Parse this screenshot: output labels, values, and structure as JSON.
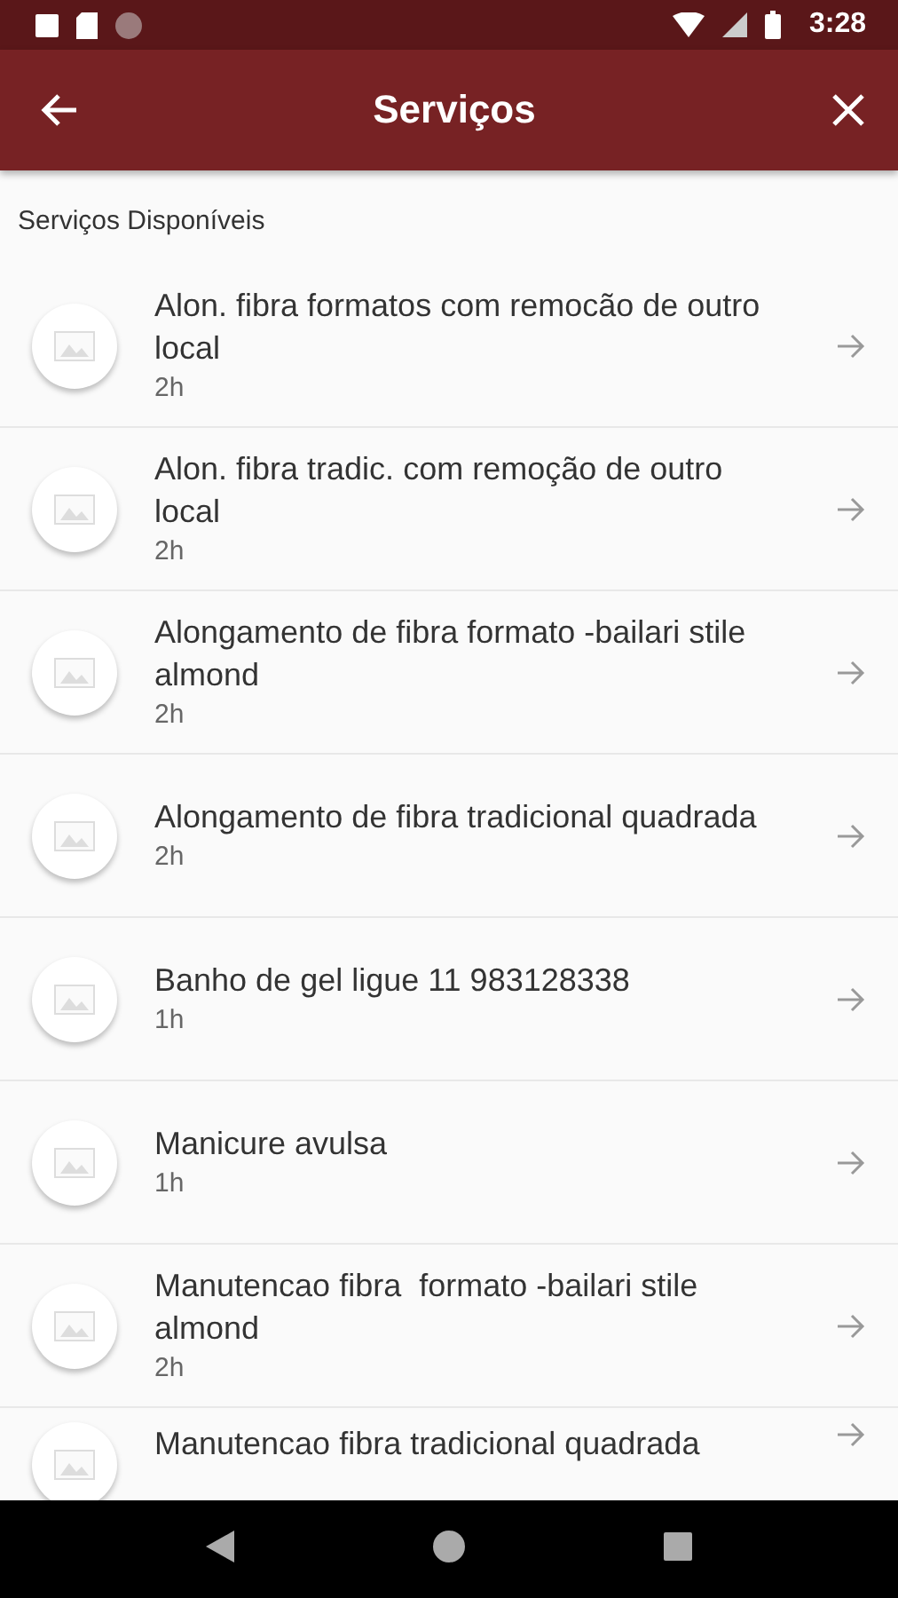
{
  "status_bar": {
    "time": "3:28"
  },
  "app_bar": {
    "title": "Serviços"
  },
  "section_title": "Serviços Disponíveis",
  "services": [
    {
      "name": "Alon. fibra formatos com remocão de outro local",
      "duration": "2h"
    },
    {
      "name": "Alon. fibra tradic. com remoção de outro local",
      "duration": "2h"
    },
    {
      "name": "Alongamento de fibra formato -bailari stile almond",
      "duration": "2h"
    },
    {
      "name": "Alongamento de fibra tradicional quadrada",
      "duration": "2h"
    },
    {
      "name": "Banho de gel ligue 11 983128338",
      "duration": "1h"
    },
    {
      "name": "Manicure avulsa",
      "duration": "1h"
    },
    {
      "name": "Manutencao fibra  formato -bailari stile almond",
      "duration": "2h"
    },
    {
      "name": "Manutencao fibra tradicional quadrada"
    }
  ]
}
